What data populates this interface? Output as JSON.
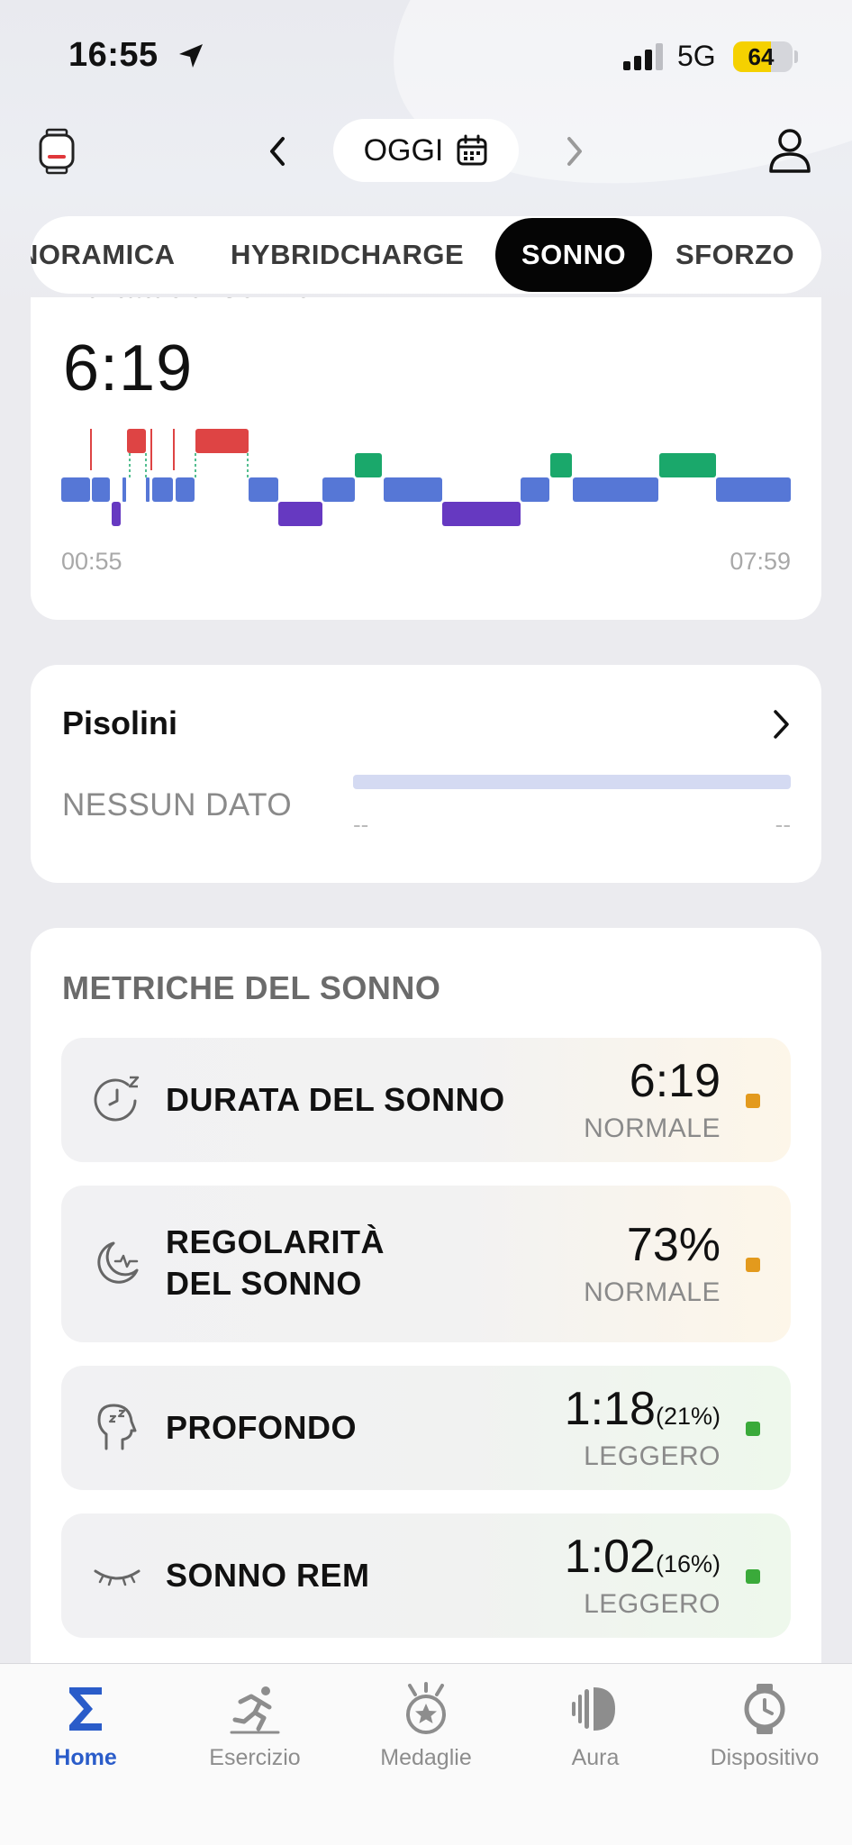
{
  "status_bar": {
    "time": "16:55",
    "network": "5G",
    "battery": "64",
    "battery_level": 0.64
  },
  "header": {
    "date_label": "OGGI"
  },
  "tabs": [
    {
      "label": "NORAMICA"
    },
    {
      "label": "HYBRIDCHARGE"
    },
    {
      "label": "SONNO",
      "active": true
    },
    {
      "label": "SFORZO"
    }
  ],
  "sleep_card": {
    "cut_title": "Durata del sonno",
    "duration": "6:19",
    "start_time": "00:55",
    "end_time": "07:59",
    "stage_colors": {
      "awake": "#de4444",
      "rem": "#1aa86b",
      "light": "#5677d6",
      "deep": "#6639c1"
    }
  },
  "naps_card": {
    "title": "Pisolini",
    "empty_text": "NESSUN DATO",
    "range_start": "--",
    "range_end": "--"
  },
  "metrics": {
    "title": "METRICHE DEL SONNO",
    "items": [
      {
        "label_line1": "DURATA DEL SONNO",
        "label_line2": "",
        "value": "6:19",
        "percent": "",
        "status": "NORMALE",
        "status_color": "#e39a1d",
        "icon": "sleep-clock-icon"
      },
      {
        "label_line1": "REGOLARITÀ",
        "label_line2": "DEL SONNO",
        "value": "73%",
        "percent": "",
        "status": "NORMALE",
        "status_color": "#e39a1d",
        "icon": "moon-pulse-icon"
      },
      {
        "label_line1": "PROFONDO",
        "label_line2": "",
        "value": "1:18",
        "percent": "(21%)",
        "status": "LEGGERO",
        "status_color": "#3aaa3a",
        "icon": "head-zzz-icon"
      },
      {
        "label_line1": "SONNO REM",
        "label_line2": "",
        "value": "1:02",
        "percent": "(16%)",
        "status": "LEGGERO",
        "status_color": "#3aaa3a",
        "icon": "closed-eye-icon"
      }
    ]
  },
  "bottom_nav": [
    {
      "label": "Home",
      "icon": "sigma-icon",
      "active": true
    },
    {
      "label": "Esercizio",
      "icon": "runner-icon"
    },
    {
      "label": "Medaglie",
      "icon": "medal-icon"
    },
    {
      "label": "Aura",
      "icon": "aura-icon"
    },
    {
      "label": "Dispositivo",
      "icon": "watch-icon"
    }
  ]
}
